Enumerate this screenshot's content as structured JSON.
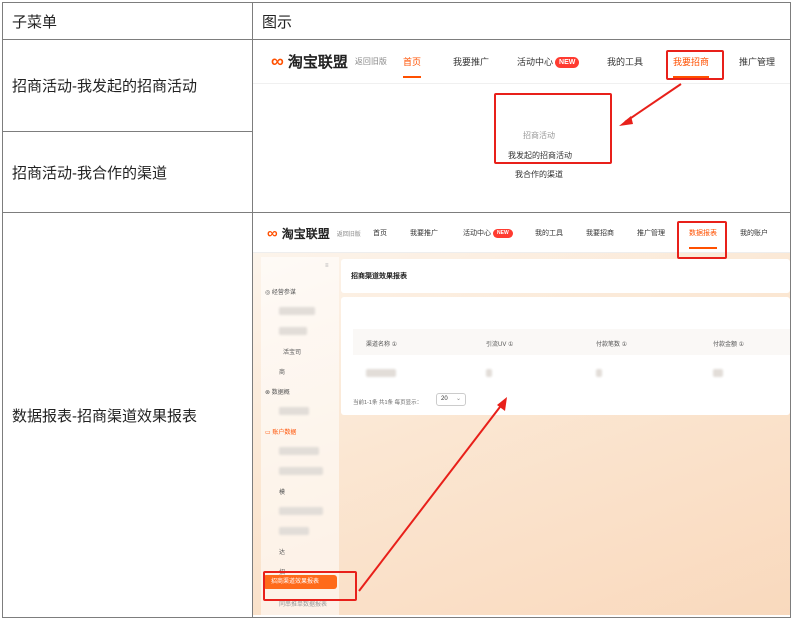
{
  "table": {
    "header": {
      "col1": "子菜单",
      "col2": "图示"
    },
    "rows": [
      {
        "label": "招商活动-我发起的招商活动"
      },
      {
        "label": "招商活动-我合作的渠道"
      },
      {
        "label": "数据报表-招商渠道效果报表"
      }
    ]
  },
  "shot1": {
    "logo_text": "淘宝联盟",
    "old_version": "返回旧版",
    "nav": [
      "首页",
      "我要推广",
      "活动中心",
      "我的工具",
      "我要招商",
      "推广管理"
    ],
    "badge_new": "NEW",
    "dropdown": {
      "title": "招商活动",
      "items": [
        "我发起的招商活动",
        "我合作的渠道"
      ]
    }
  },
  "shot2": {
    "logo_text": "淘宝联盟",
    "old_version": "返回旧版",
    "nav": [
      "首页",
      "我要推广",
      "活动中心",
      "我的工具",
      "我要招商",
      "推广管理",
      "数据报表",
      "我的账户"
    ],
    "badge_new": "NEW",
    "sidebar": {
      "section_1": "经营参谋",
      "section_2": "数据概",
      "section_3": "账户数据",
      "active_item": "招商渠道效果报表",
      "item_partial_1": "活宝司",
      "item_partial_2": "商",
      "item_partial_3": "模",
      "item_partial_4": "达",
      "item_partial_5": "招",
      "item_below": "同串推单数据报表"
    },
    "report_title": "招商渠道效果报表",
    "columns": [
      "渠道名称 ①",
      "引流UV ①",
      "付款笔数 ①",
      "付款金额 ①"
    ],
    "pager_text": "当前1-1条 共1条   每页显示：",
    "page_size": "20",
    "collapse_icon": "≡"
  },
  "colors": {
    "accent": "#ff5000",
    "annotation_red": "#e8201a"
  }
}
